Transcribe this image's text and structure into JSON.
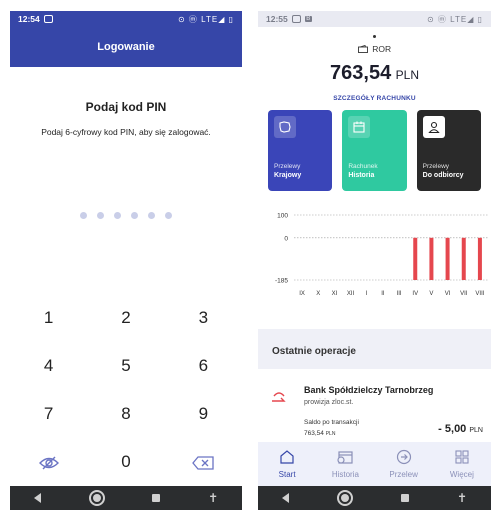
{
  "left": {
    "status": {
      "time": "12:54",
      "right": "⊙ ⓜ LTE◢ ▯"
    },
    "appbar": {
      "title": "Logowanie"
    },
    "pin": {
      "title": "Podaj kod PIN",
      "subtitle": "Podaj 6-cyfrowy kod PIN, aby się zalogować.",
      "dot_count": 6
    },
    "keypad": {
      "rows": [
        [
          "1",
          "2",
          "3"
        ],
        [
          "4",
          "5",
          "6"
        ],
        [
          "7",
          "8",
          "9"
        ]
      ],
      "zero": "0"
    },
    "icons": [
      "eye-off-icon",
      "backspace-icon"
    ]
  },
  "right": {
    "status": {
      "time": "12:55",
      "right": "⊙ ⓜ LTE◢ ▯"
    },
    "account": {
      "name": "ROR",
      "balance": "763,54",
      "currency": "PLN",
      "details_link": "SZCZEGÓŁY RACHUNKU"
    },
    "tiles": [
      {
        "line1": "Przelewy",
        "line2": "Krajowy",
        "color": "#3a45b8",
        "icon": "map-icon"
      },
      {
        "line1": "Rachunek",
        "line2": "Historia",
        "color": "#2fc9a0",
        "icon": "calendar-icon"
      },
      {
        "line1": "Przelewy",
        "line2": "Do odbiorcy",
        "color": "#2a2a2a",
        "icon": "person-icon"
      }
    ],
    "chart_data": {
      "type": "bar",
      "categories": [
        "IX",
        "X",
        "XI",
        "XII",
        "I",
        "II",
        "III",
        "IV",
        "V",
        "VI",
        "VII",
        "VIII"
      ],
      "values": [
        0,
        0,
        0,
        0,
        0,
        0,
        0,
        -185,
        -185,
        -185,
        -185,
        -185
      ],
      "ylim": [
        -185,
        100
      ],
      "yticks": [
        "100",
        "0",
        "-185"
      ],
      "grid": true,
      "bar_color": "#e5474e"
    },
    "operations": {
      "header": "Ostatnie operacje",
      "items": [
        {
          "title": "Bank Spółdzielczy Tarnobrzeg",
          "description": "prowizja zloc.st.",
          "balance_label": "Saldo po transakcji",
          "balance_value": "763,54",
          "balance_currency": "PLN",
          "amount": "- 5,00",
          "currency": "PLN"
        }
      ]
    },
    "tabs": [
      {
        "label": "Start",
        "icon": "home-icon",
        "active": true
      },
      {
        "label": "Historia",
        "icon": "history-icon",
        "active": false
      },
      {
        "label": "Przelew",
        "icon": "transfer-icon",
        "active": false
      },
      {
        "label": "Więcej",
        "icon": "grid-icon",
        "active": false
      }
    ]
  }
}
